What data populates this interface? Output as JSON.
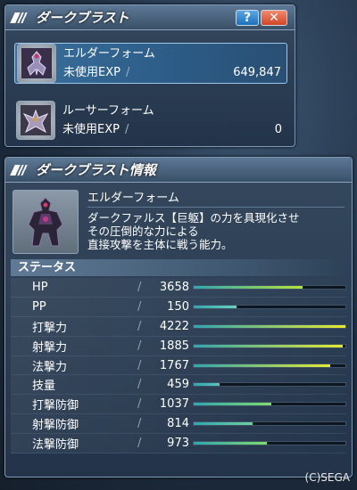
{
  "window1": {
    "title": "ダークブラスト",
    "help_label": "?",
    "close_label": "✕",
    "forms": [
      {
        "name": "エルダーフォーム",
        "exp_label": "未使用EXP",
        "slash": "/",
        "exp_value": "649,847",
        "selected": true
      },
      {
        "name": "ルーサーフォーム",
        "exp_label": "未使用EXP",
        "slash": "/",
        "exp_value": "0",
        "selected": false
      }
    ]
  },
  "window2": {
    "title": "ダークブラスト情報",
    "form_name": "エルダーフォーム",
    "description": [
      "ダークファルス【巨躯】の力を具現化させ",
      "その圧倒的な力による",
      "直接攻撃を主体に戦う能力。"
    ],
    "status_header": "ステータス",
    "stats": [
      {
        "label": "HP",
        "slash": "/",
        "value": "3658",
        "fill": 0.72,
        "colors": [
          "#2fa7b0",
          "#b6e43a"
        ]
      },
      {
        "label": "PP",
        "slash": "/",
        "value": "150",
        "fill": 0.28,
        "colors": [
          "#2fa7b0",
          "#6fd0c0"
        ]
      },
      {
        "label": "打撃力",
        "slash": "/",
        "value": "4222",
        "fill": 1.0,
        "colors": [
          "#2fa7b0",
          "#e6ea2e"
        ]
      },
      {
        "label": "射撃力",
        "slash": "/",
        "value": "1885",
        "fill": 0.98,
        "colors": [
          "#2fa7b0",
          "#e6ea2e"
        ]
      },
      {
        "label": "法撃力",
        "slash": "/",
        "value": "1767",
        "fill": 0.9,
        "colors": [
          "#2fa7b0",
          "#e6ea2e"
        ]
      },
      {
        "label": "技量",
        "slash": "/",
        "value": "459",
        "fill": 0.17,
        "colors": [
          "#2fa7b0",
          "#5cc2b8"
        ]
      },
      {
        "label": "打撃防御",
        "slash": "/",
        "value": "1037",
        "fill": 0.51,
        "colors": [
          "#2fa7b0",
          "#7fdc6b"
        ]
      },
      {
        "label": "射撃防御",
        "slash": "/",
        "value": "814",
        "fill": 0.39,
        "colors": [
          "#2fa7b0",
          "#6fd0a0"
        ]
      },
      {
        "label": "法撃防御",
        "slash": "/",
        "value": "973",
        "fill": 0.48,
        "colors": [
          "#2fa7b0",
          "#7fdc6b"
        ]
      }
    ]
  },
  "copyright": "(C)SEGA",
  "icons": {
    "form1": "armored-warrior-icon",
    "form2": "winged-warrior-icon",
    "portrait": "dark-falz-elder-portrait"
  }
}
